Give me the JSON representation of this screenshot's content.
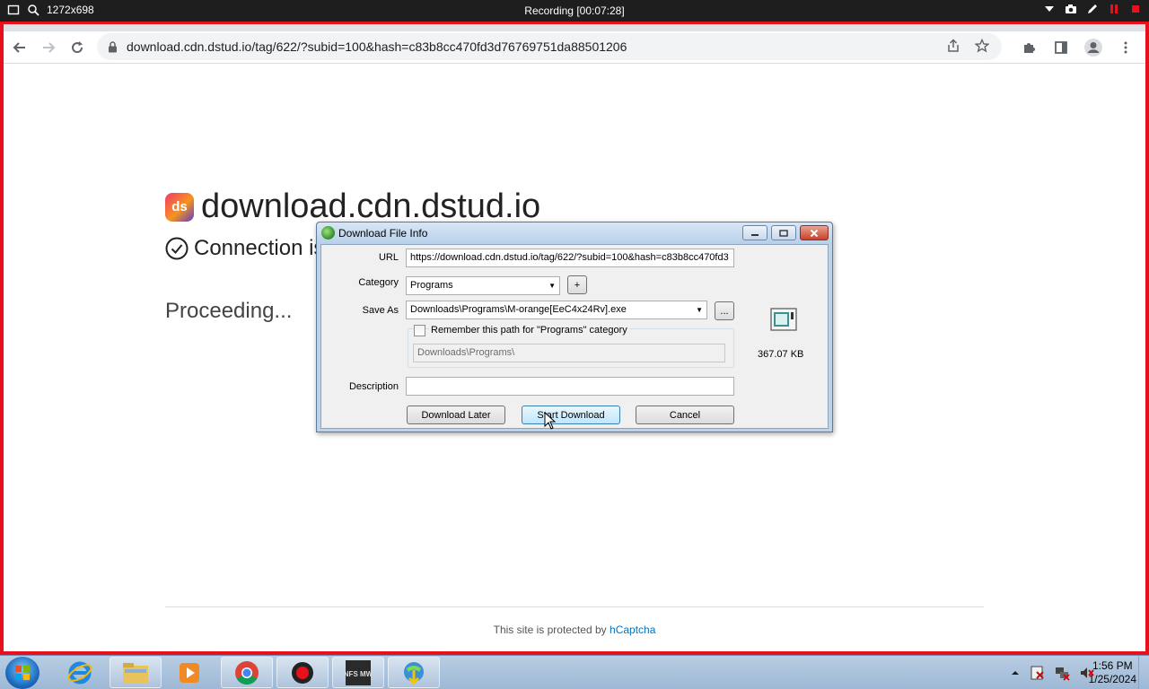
{
  "recorder": {
    "resolution": "1272x698",
    "title": "Recording [00:07:28]"
  },
  "browser": {
    "url": "download.cdn.dstud.io/tag/622/?subid=100&hash=c83b8cc470fd3d76769751da88501206"
  },
  "page": {
    "logo_text": "ds",
    "site_title": "download.cdn.dstud.io",
    "connection_text": "Connection is",
    "proceeding_text": "Proceeding...",
    "footer_prefix": "This site is protected by",
    "footer_link": "hCaptcha"
  },
  "dialog": {
    "title": "Download File Info",
    "url_label": "URL",
    "url_value": "https://download.cdn.dstud.io/tag/622/?subid=100&hash=c83b8cc470fd3",
    "category_label": "Category",
    "category_value": "Programs",
    "add_category_label": "+",
    "save_as_label": "Save As",
    "save_as_value": "Downloads\\Programs\\M-orange[EeC4x24Rv].exe",
    "browse_label": "...",
    "remember_label": "Remember this path for \"Programs\" category",
    "remember_checked": false,
    "remember_path": "Downloads\\Programs\\",
    "description_label": "Description",
    "description_value": "",
    "file_size": "367.07  KB",
    "buttons": {
      "later": "Download Later",
      "start": "Start Download",
      "cancel": "Cancel"
    }
  },
  "taskbar": {
    "apps": [
      "internet-explorer",
      "file-explorer",
      "media-player",
      "chrome",
      "recorder",
      "nfs-mw",
      "internet-download-manager"
    ],
    "apps_labels": {
      "nfs": "NFS MW"
    },
    "time": "1:56 PM",
    "date": "1/25/2024"
  },
  "colors": {
    "recording_frame": "#e8101a",
    "link": "#0074bf"
  }
}
